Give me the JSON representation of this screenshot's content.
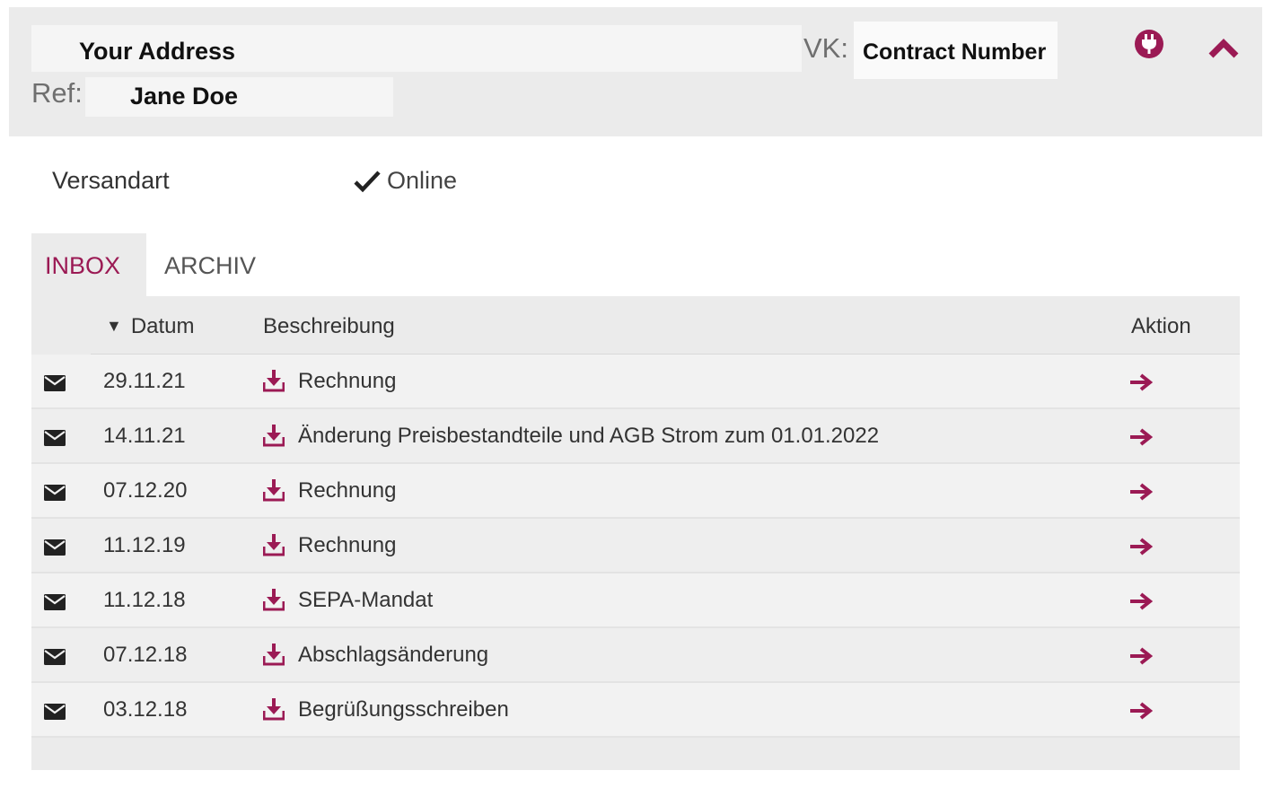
{
  "header": {
    "address": "Your Address",
    "vk_label": "VK:",
    "contract_number": "Contract Number",
    "ref_label": "Ref:",
    "ref_name": "Jane Doe",
    "icons": {
      "plug": "plug-icon",
      "collapse": "chevron-up-icon"
    }
  },
  "versand": {
    "label": "Versandart",
    "value": "Online",
    "icon": "check-icon"
  },
  "tabs": [
    {
      "label": "INBOX",
      "active": true
    },
    {
      "label": "ARCHIV",
      "active": false
    }
  ],
  "table": {
    "columns": {
      "date": "Datum",
      "description": "Beschreibung",
      "action": "Aktion"
    },
    "sort_indicator": "▼",
    "rows": [
      {
        "date": "29.11.21",
        "description": "Rechnung"
      },
      {
        "date": "14.11.21",
        "description": "Änderung Preisbestandteile und AGB Strom zum 01.01.2022"
      },
      {
        "date": "07.12.20",
        "description": "Rechnung"
      },
      {
        "date": "11.12.19",
        "description": "Rechnung"
      },
      {
        "date": "11.12.18",
        "description": "SEPA-Mandat"
      },
      {
        "date": "07.12.18",
        "description": "Abschlagsänderung"
      },
      {
        "date": "03.12.18",
        "description": "Begrüßungsschreiben"
      }
    ]
  },
  "colors": {
    "accent": "#9b1a54",
    "header_bg": "#ebebeb",
    "text": "#333333"
  }
}
